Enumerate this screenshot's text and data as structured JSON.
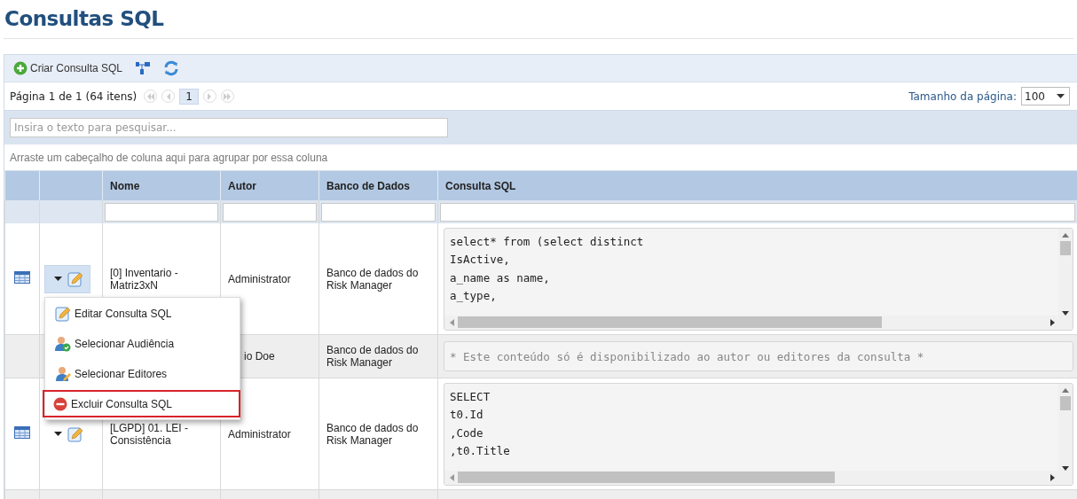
{
  "page_title": "Consultas SQL",
  "toolbar": {
    "create_label": "Criar Consulta SQL"
  },
  "pager": {
    "summary": "Página 1 de 1 (64 itens)",
    "pages": [
      {
        "label": "1",
        "selected": true
      }
    ],
    "page_size_label": "Tamanho da página:",
    "page_size": "100"
  },
  "search": {
    "placeholder": "Insira o texto para pesquisar..."
  },
  "group_panel": "Arraste um cabeçalho de coluna aqui para agrupar por essa coluna",
  "table": {
    "columns": [
      "Nome",
      "Autor",
      "Banco de Dados",
      "Consulta SQL"
    ],
    "rows": [
      {
        "kind": "query",
        "active": true,
        "name": "[0] Inventario - Matriz3xN",
        "author": "Administrator",
        "database": "Banco de dados do Risk Manager",
        "sql": [
          "select* from (select distinct",
          "IsActive,",
          "a_name as name,",
          "a_type,"
        ]
      },
      {
        "kind": "restricted",
        "author": "io Doe",
        "database": "Banco de dados do Risk Manager",
        "notice": "* Este conteúdo só é disponibilizado ao autor ou editores da consulta *"
      },
      {
        "kind": "query",
        "active": false,
        "name": "[LGPD] 01. LEI - Consistência",
        "author": "Administrator",
        "database": "Banco de dados do Risk Manager",
        "sql": [
          "SELECT",
          "t0.Id",
          ",Code",
          ",t0.Title"
        ]
      }
    ]
  },
  "context_menu": {
    "items": [
      {
        "kind": "edit",
        "label": "Editar Consulta SQL",
        "selected": false
      },
      {
        "kind": "audience",
        "label": "Selecionar Audiência",
        "selected": false
      },
      {
        "kind": "editors",
        "label": "Selecionar Editores",
        "selected": false
      },
      {
        "kind": "delete",
        "label": "Excluir Consulta SQL",
        "selected": true
      }
    ]
  }
}
